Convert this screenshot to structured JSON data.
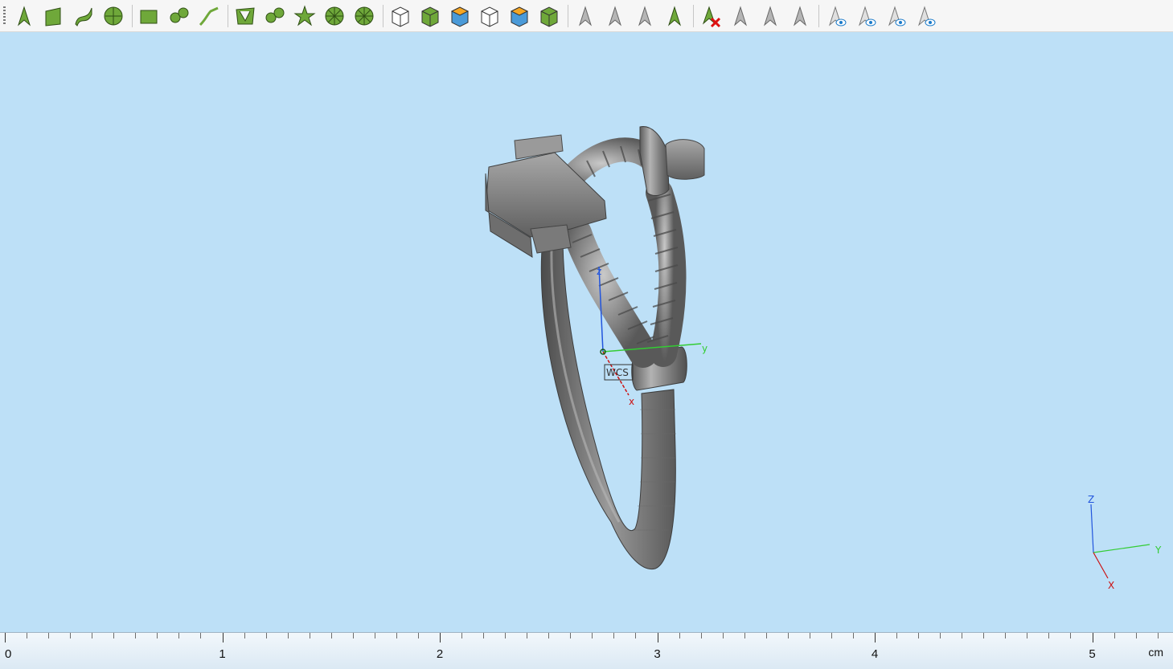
{
  "toolbar": {
    "groups": [
      [
        "select-object-icon",
        "select-face-icon",
        "select-curve-icon",
        "select-sphere-icon"
      ],
      [
        "rectangle-select-icon",
        "lasso-select-icon",
        "select-path-icon"
      ],
      [
        "mesh-select-icon",
        "select-blob-icon",
        "select-star-icon",
        "select-wheel-icon",
        "select-radial-icon"
      ],
      [
        "box-view-icon",
        "box-view-shaded-icon",
        "box-view-colored-icon",
        "box-wire-icon",
        "box-highlight-icon",
        "box-green-icon"
      ],
      [
        "select-grey-icon",
        "select-deselect-icon",
        "select-invert-icon",
        "select-transform-icon"
      ],
      [
        "delete-selection-icon",
        "hide-selection-icon",
        "copy-selection-icon",
        "paste-selection-icon"
      ],
      [
        "show-hidden-icon",
        "show-refresh-icon",
        "show-eye-icon",
        "show-wire-eye-icon"
      ]
    ]
  },
  "viewport": {
    "background": "#bde0f7",
    "wcs_label": "WCS",
    "local_axes": {
      "x": "x",
      "y": "y",
      "z": "z"
    },
    "corner_axes": {
      "x": "X",
      "y": "Y",
      "z": "Z"
    }
  },
  "ruler": {
    "labels": [
      "0",
      "1",
      "2",
      "3",
      "4",
      "5"
    ],
    "unit": "cm"
  },
  "colors": {
    "toolbar_green": "#6fa83a",
    "axis_x": "#cc1111",
    "axis_y": "#33cc33",
    "axis_z": "#2255dd",
    "model_grey": "#8a8a8a"
  }
}
